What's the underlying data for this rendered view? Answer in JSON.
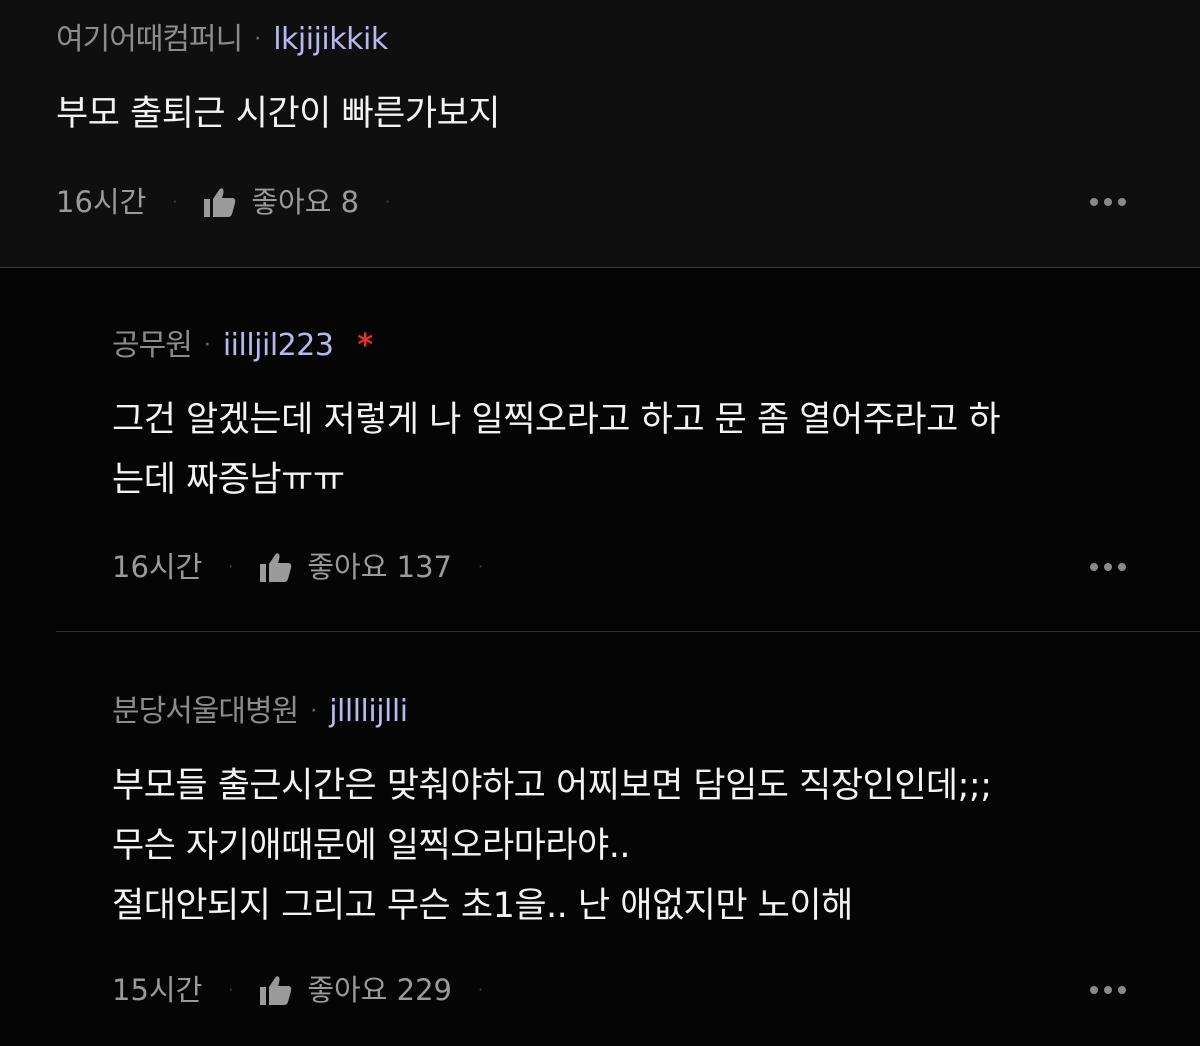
{
  "comments": [
    {
      "company": "여기어때컴퍼니",
      "username": "lkjijikkik",
      "body": "부모 출퇴근 시간이 빠른가보지",
      "time": "16시간",
      "like_label": "좋아요 8"
    },
    {
      "company": "공무원",
      "username": "iilljil223",
      "op_mark": "*",
      "body": "그건 알겠는데 저렇게 나 일찍오라고 하고 문 좀 열어주라고 하\n는데 짜증남ㅠㅠ",
      "time": "16시간",
      "like_label": "좋아요 137"
    },
    {
      "company": "분당서울대병원",
      "username": "jllllijlli",
      "body": "부모들 출근시간은 맞춰야하고 어찌보면 담임도 직장인인데;;;\n무슨 자기애때문에 일찍오라마라야..\n절대안되지 그리고 무슨 초1을.. 난 애없지만 노이해",
      "time": "15시간",
      "like_label": "좋아요 229"
    }
  ],
  "separator": "·",
  "icons": {
    "like": "thumbs-up-icon",
    "more": "more-horizontal-icon"
  },
  "colors": {
    "background": "#050505",
    "top_comment_background": "#0f0f0f",
    "username": "#b8b8f0",
    "op_mark": "#e0302c"
  }
}
